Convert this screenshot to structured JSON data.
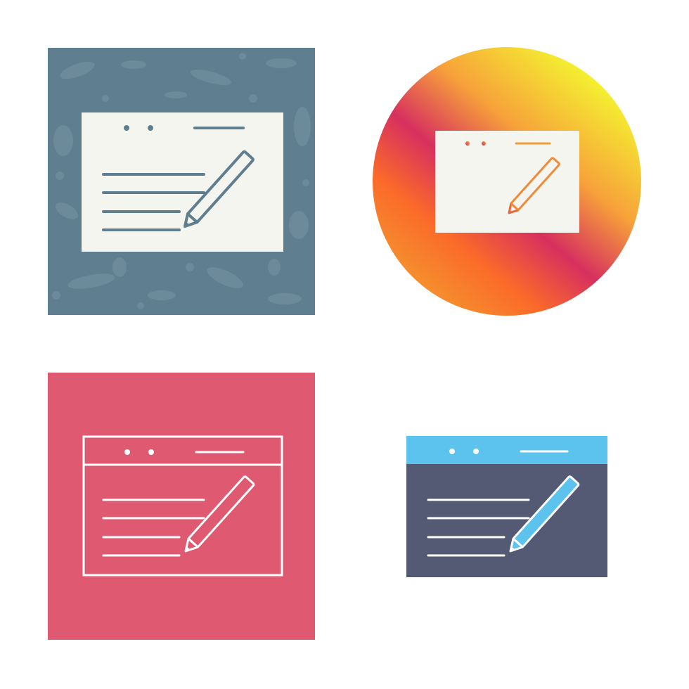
{
  "colors": {
    "background": "#ffffff",
    "slate_tile": "#5f7e8f",
    "slate_texture": "#6f8d9c",
    "paper": "#f5f5ef",
    "slate_stroke": "#5f7e8f",
    "gradient_yellow": "#f4f730",
    "gradient_orange": "#f7a23a",
    "gradient_magenta": "#d7305f",
    "gradient_red_orange": "#fb6a2a",
    "crimson_tile": "#df5a70",
    "outline_white": "#ffffff",
    "sky_blue": "#5bc3ee",
    "navy_slate": "#545a74"
  },
  "icons": [
    {
      "name": "browser-edit-icon",
      "style": "glyph-on-textured-square"
    },
    {
      "name": "browser-edit-icon",
      "style": "glyph-on-gradient-circle"
    },
    {
      "name": "browser-edit-icon",
      "style": "outline-on-square"
    },
    {
      "name": "browser-edit-icon",
      "style": "flat-two-tone"
    }
  ]
}
